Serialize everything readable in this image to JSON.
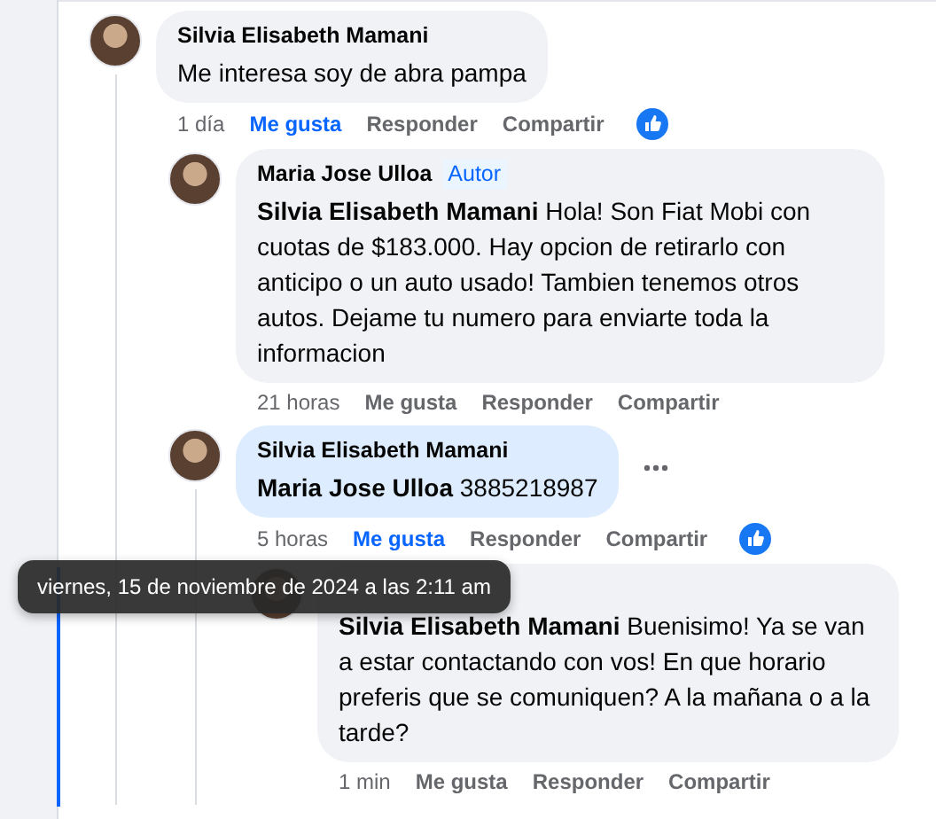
{
  "comments": [
    {
      "author": "Silvia Elisabeth Mamani",
      "text": "Me interesa soy de abra pampa",
      "time": "1 día",
      "actions": [
        "Me gusta",
        "Responder",
        "Compartir"
      ],
      "liked": true,
      "reacted": true,
      "highlighted": false,
      "more_menu": false,
      "children": [
        {
          "author": "Maria Jose Ulloa",
          "badge": "Autor",
          "mention": "Silvia Elisabeth Mamani",
          "text": "Hola! Son Fiat Mobi con cuotas de $183.000. Hay opcion de retirarlo con anticipo o un auto usado! Tambien tenemos otros autos. Dejame tu numero para enviarte toda la informacion",
          "time": "21 horas",
          "actions": [
            "Me gusta",
            "Responder",
            "Compartir"
          ],
          "liked": false,
          "reacted": false,
          "highlighted": false,
          "more_menu": false
        },
        {
          "author": "Silvia Elisabeth Mamani",
          "mention": "Maria Jose Ulloa",
          "text": "3885218987",
          "time": "5 horas",
          "actions": [
            "Me gusta",
            "Responder",
            "Compartir"
          ],
          "liked": true,
          "reacted": true,
          "highlighted": true,
          "more_menu": true,
          "children": [
            {
              "mention": "Silvia Elisabeth Mamani",
              "text": "Buenisimo! Ya se van a estar contactando con vos! En que horario preferis que se comuniquen? A la mañana o a la tarde?",
              "time": "1 min",
              "actions": [
                "Me gusta",
                "Responder",
                "Compartir"
              ],
              "liked": false,
              "reacted": false,
              "highlighted": false,
              "more_menu": false
            }
          ]
        }
      ]
    }
  ],
  "tooltip": {
    "text": "viernes, 15 de noviembre de 2024 a las 2:11 am"
  }
}
